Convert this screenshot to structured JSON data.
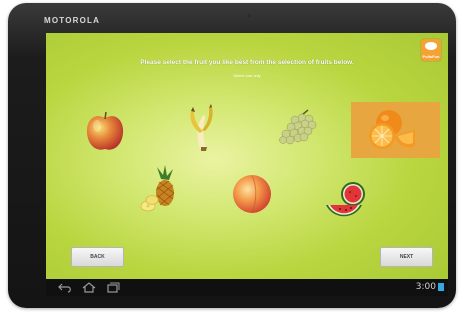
{
  "device": {
    "brand": "MOTOROLA"
  },
  "app": {
    "logo_text": "PollsFun",
    "prompt": "Please select the fruit you like best from the selection of fruits below.",
    "instruction": "Select one only"
  },
  "fruits": [
    {
      "name": "Apple",
      "selected": false
    },
    {
      "name": "Banana",
      "selected": false
    },
    {
      "name": "Grapes",
      "selected": false
    },
    {
      "name": "Orange",
      "selected": true
    },
    {
      "name": "Pineapple",
      "selected": false
    },
    {
      "name": "Peach",
      "selected": false
    },
    {
      "name": "Watermelon",
      "selected": false
    }
  ],
  "buttons": {
    "back": "BACK",
    "next": "NEXT"
  },
  "status_bar": {
    "time": "3:00"
  },
  "colors": {
    "selection": "#e8a640",
    "screen_green": "#b9d640"
  },
  "icons": [
    "back-arrow-icon",
    "home-icon",
    "recent-apps-icon",
    "signal-icon"
  ]
}
